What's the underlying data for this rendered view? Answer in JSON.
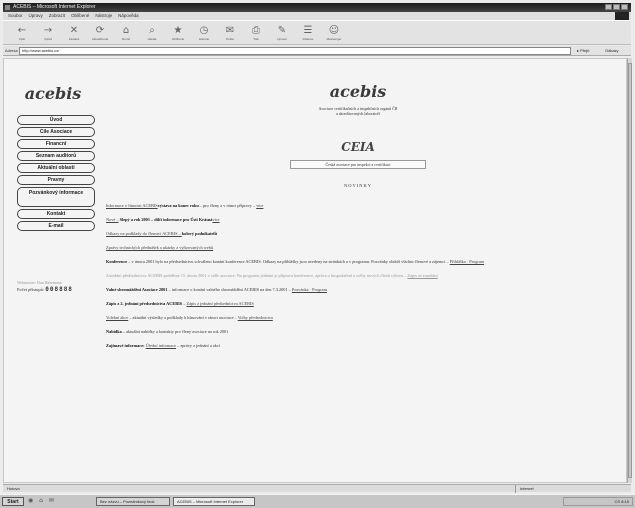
{
  "window": {
    "title": "ACEBIS – Microsoft Internet Explorer"
  },
  "menubar": {
    "items": [
      "Soubor",
      "Úpravy",
      "Zobrazit",
      "Oblíbené",
      "Nástroje",
      "Nápověda"
    ],
    "brand": "IE"
  },
  "toolbar": {
    "buttons": [
      {
        "label": "Zpět",
        "icon": "back-arrow-icon",
        "glyph": "←"
      },
      {
        "label": "Vpřed",
        "icon": "forward-arrow-icon",
        "glyph": "→"
      },
      {
        "label": "Zastavit",
        "icon": "stop-icon",
        "glyph": "✕"
      },
      {
        "label": "Aktualizovat",
        "icon": "refresh-icon",
        "glyph": "⟳"
      },
      {
        "label": "Domů",
        "icon": "home-icon",
        "glyph": "⌂"
      },
      {
        "label": "Hledat",
        "icon": "search-icon",
        "glyph": "⌕"
      },
      {
        "label": "Oblíbené",
        "icon": "favorites-icon",
        "glyph": "★"
      },
      {
        "label": "Historie",
        "icon": "history-icon",
        "glyph": "◷"
      },
      {
        "label": "Pošta",
        "icon": "mail-icon",
        "glyph": "✉"
      },
      {
        "label": "Tisk",
        "icon": "print-icon",
        "glyph": "⎙"
      },
      {
        "label": "Upravit",
        "icon": "edit-icon",
        "glyph": "✎"
      },
      {
        "label": "Diskuse",
        "icon": "discuss-icon",
        "glyph": "☰"
      },
      {
        "label": "Messenger",
        "icon": "messenger-icon",
        "glyph": "☺"
      }
    ]
  },
  "address": {
    "label": "Adresa",
    "value": "http://www.acebis.cz/",
    "go": "Přejít",
    "links": "Odkazy"
  },
  "sidebar": {
    "logo": "acebis",
    "nav": [
      "Úvod",
      "Cíle Asociace",
      "Financní",
      "Seznam auditorů",
      "Aktuální oblasti",
      "Pravny",
      "Pozvánkový informace",
      "Kontakt",
      "E-mail"
    ],
    "webmaster": "Webmaster: Dan Haltrmann",
    "counter_label": "Počet přístupů:",
    "counter_value": "008888"
  },
  "header": {
    "logo": "acebis",
    "org_line1": "Asociace certifikačních a inspekčních orgánů ČR",
    "org_line2": "a akreditovaných laboratoří",
    "ceia_logo": "CEIA",
    "ceia_line": "Česká asociace pro inspekci a certifikaci",
    "novinky": "NOVINKY"
  },
  "news": [
    {
      "lead": "Informace o činnosti ACEBIS",
      "text": " – pro členy a v rámci přípravy – ",
      "bold": "výstava na konec roku",
      "link": "více"
    },
    {
      "lead": "Nové –",
      "bold": " Slepý a rok 2001 – dílčí informace pro Ústí Krásná",
      "link": "více"
    },
    {
      "lead": "Odkazy na podklady do členství ACEBIS – ",
      "bold": "kolový podnikatelů"
    },
    {
      "lead": "Zprávy technických přednášek a ukázky z vyřizovaných webů"
    },
    {
      "bold": "Konference",
      "text": " – v únoru 2001 bylo na předsednictvu schváleno konání konference ACEBIS. Odkazy na přihlášky jsou uvedeny na stránkách a v programu. Pozvánky obdrží všichni členové a zájemci – ",
      "link": "Přihláška · Program"
    },
    {
      "faint": true,
      "text": "Zasedání předsednictva ACEBIS proběhne 15. února 2001 v sídle asociace. Na programu jednání je příprava konference, zpráva o hospodaření a volby nových členů výboru – ",
      "link": "Zápis ze zasedání"
    },
    {
      "bold": "Valné shromáždění Asociace 2001",
      "text": " – informace o konání valného shromáždění ACEBIS na den 7.3.2001 – ",
      "link": "Pozvánka · Program"
    },
    {
      "bold": "Zápis z 2. jednání předsednictva ACEBIS",
      "text": " – ",
      "link": "Zápis z jednání předsednictva ACEBIS"
    },
    {
      "lead": "Volební akce",
      "text": " – aktuální výsledky a podklady k hlasování v rámci asociace – ",
      "link": "Volby předsednictva"
    },
    {
      "bold": "Nabídka",
      "text": " – aktuální nabídky a kontakty pro členy asociace na rok 2001"
    },
    {
      "bold": "Zajímavé informace:",
      "text": " ",
      "link": "Úřední informace",
      "tail": " – zprávy z jednání a akcí"
    }
  ],
  "status": {
    "left": "Hotovo",
    "right": "Internet"
  },
  "taskbar": {
    "start": "Start",
    "quick": "◉ ⌂ ✉",
    "task1": "Bez názvu – Poznámkový blok",
    "task2": "ACEBIS – Microsoft Internet Explorer",
    "tray": "CS 8:15"
  }
}
